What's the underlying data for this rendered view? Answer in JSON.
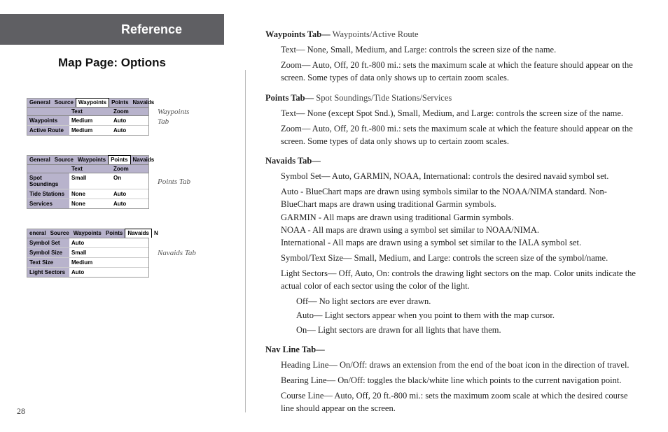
{
  "left": {
    "reference": "Reference",
    "subtitle": "Map Page: Options",
    "page_num": "28",
    "shot1": {
      "caption": "Waypoints Tab",
      "tabs": [
        "General",
        "Source",
        "Waypoints",
        "Points",
        "Navaids"
      ],
      "sel_idx": 2,
      "head": [
        "",
        "Text",
        "Zoom"
      ],
      "rows": [
        {
          "label": "Waypoints",
          "text": "Medium",
          "zoom": "Auto"
        },
        {
          "label": "Active Route",
          "text": "Medium",
          "zoom": "Auto"
        }
      ]
    },
    "shot2": {
      "caption": "Points Tab",
      "tabs": [
        "General",
        "Source",
        "Waypoints",
        "Points",
        "Navaids"
      ],
      "sel_idx": 3,
      "head": [
        "",
        "Text",
        "Zoom"
      ],
      "rows": [
        {
          "label": "Spot Soundings",
          "text": "Small",
          "zoom": "On"
        },
        {
          "label": "Tide Stations",
          "text": "None",
          "zoom": "Auto"
        },
        {
          "label": "Services",
          "text": "None",
          "zoom": "Auto"
        }
      ]
    },
    "shot3": {
      "caption": "Navaids Tab",
      "tabs": [
        "eneral",
        "Source",
        "Waypoints",
        "Points",
        "Navaids",
        "N"
      ],
      "sel_idx": 4,
      "rows": [
        {
          "label": "Symbol Set",
          "val": "Auto"
        },
        {
          "label": "Symbol Size",
          "val": "Small"
        },
        {
          "label": "Text Size",
          "val": "Medium"
        },
        {
          "label": "Light Sectors",
          "val": "Auto"
        }
      ]
    }
  },
  "right": {
    "s1": {
      "title": "Waypoints Tab—",
      "sub": "  Waypoints/Active Route",
      "p1": "Text— None, Small, Medium, and Large: controls the screen size of the name.",
      "p2": "Zoom— Auto, Off, 20 ft.-800 mi.: sets the maximum scale at which the feature should appear on the screen. Some types of data only shows up to certain zoom scales."
    },
    "s2": {
      "title": "Points Tab—",
      "sub": "  Spot Soundings/Tide Stations/Services",
      "p1": "Text— None (except Spot Snd.), Small, Medium, and Large: controls the screen size of the name.",
      "p2": "Zoom— Auto, Off, 20 ft.-800 mi.: sets the maximum scale at which the feature should appear on the screen. Some types of data only shows up to certain zoom scales."
    },
    "s3": {
      "title": "Navaids Tab—",
      "p1": "Symbol Set— Auto, GARMIN, NOAA, International: controls the desired navaid symbol set.",
      "p2a": "Auto - BlueChart maps are drawn using symbols similar to the NOAA/NIMA standard. Non-BlueChart maps are drawn using traditional Garmin symbols.",
      "p2b": "GARMIN - All maps are drawn using traditional Garmin symbols.",
      "p2c": "NOAA - All maps are drawn using a symbol set similar to NOAA/NIMA.",
      "p2d": "International - All maps are drawn using a symbol set similar to the IALA symbol set.",
      "p3": "Symbol/Text Size— Small, Medium, and Large: controls the screen size of the symbol/name.",
      "p4": "Light Sectors— Off, Auto, On: controls the drawing light sectors on the map. Color units indicate the actual color of each sector using the color of the light.",
      "p4a": "Off— No light sectors are ever drawn.",
      "p4b": "Auto— Light sectors appear when you point to them with the map cursor.",
      "p4c": "On— Light sectors are drawn for all lights that have them."
    },
    "s4": {
      "title": "Nav Line Tab—",
      "p1": "Heading Line— On/Off: draws an extension from the end of the boat icon in the direction of travel.",
      "p2": "Bearing Line— On/Off: toggles the black/white line which points to the current navigation point.",
      "p3": "Course Line— Auto, Off, 20 ft.-800 mi.: sets the maximum zoom scale at which the desired course line should appear on the screen."
    }
  }
}
